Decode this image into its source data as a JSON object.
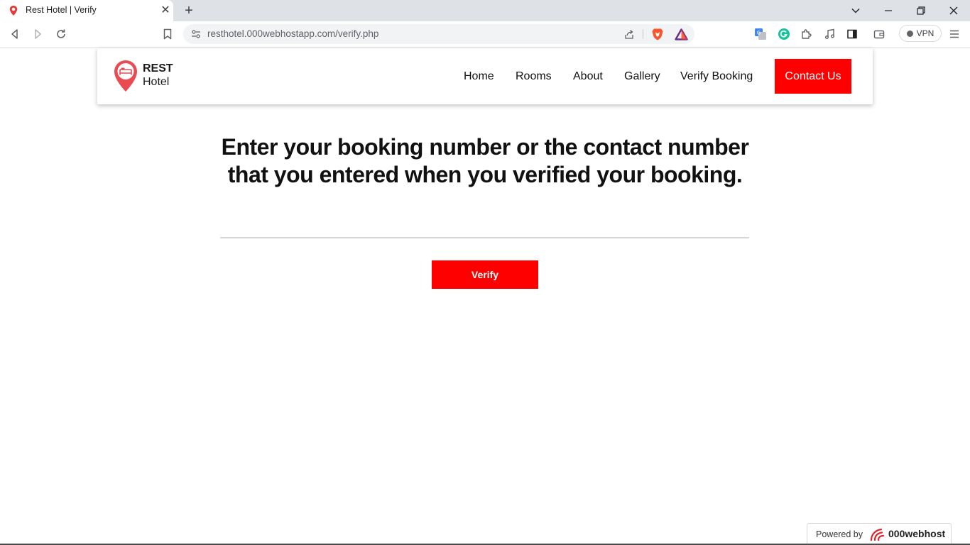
{
  "browser": {
    "tab_title": "Rest Hotel | Verify",
    "tab_close": "✕",
    "new_tab": "+",
    "url": "resthotel.000webhostapp.com/verify.php",
    "vpn_label": "VPN"
  },
  "site": {
    "logo": {
      "line1": "REST",
      "line2": "Hotel"
    },
    "nav": [
      {
        "label": "Home"
      },
      {
        "label": "Rooms"
      },
      {
        "label": "About"
      },
      {
        "label": "Gallery"
      },
      {
        "label": "Verify Booking"
      }
    ],
    "contact_label": "Contact Us",
    "accent_color": "#ff0000"
  },
  "main": {
    "heading_line1": "Enter your booking number or the contact number",
    "heading_line2": "that you entered when you verified your booking.",
    "input_value": "",
    "verify_label": "Verify"
  },
  "footer": {
    "powered_label": "Powered by",
    "brand": "000webhost"
  }
}
